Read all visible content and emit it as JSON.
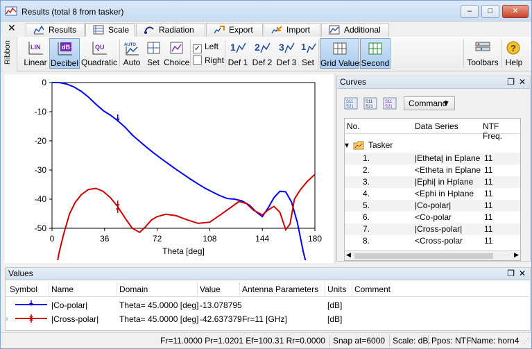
{
  "window": {
    "title": "Results (total 8 from tasker)",
    "buttons": [
      "–",
      "□",
      "✕"
    ]
  },
  "tabs": [
    {
      "label": "Results"
    },
    {
      "label": "Scale",
      "active": true
    },
    {
      "label": "Radiation"
    },
    {
      "label": "Export"
    },
    {
      "label": "Import"
    },
    {
      "label": "Additional"
    }
  ],
  "ribbon": {
    "side_label": "Ribbon",
    "close": "✕",
    "buttons": {
      "linear": "Linear",
      "decibel": "Decibel",
      "quadratic": "Quadratic",
      "auto": "Auto",
      "set": "Set",
      "choice": "Choice",
      "def1": "Def 1",
      "def2": "Def 2",
      "def3": "Def 3",
      "set2": "Set",
      "grid_values": "Grid Values",
      "second": "Second",
      "toolbars": "Toolbars",
      "help": "Help"
    },
    "left_check": {
      "label": "Left",
      "checked": true
    },
    "right_check": {
      "label": "Right",
      "checked": false
    },
    "icon_text": {
      "lin": "LIN",
      "db": "dB",
      "qu": "QU",
      "auto": "AUTO"
    }
  },
  "plot": {
    "xlabel": "Theta [deg]",
    "x_ticks": [
      "0",
      "36",
      "72",
      "108",
      "144",
      "180"
    ],
    "y_ticks": [
      "0",
      "-10",
      "-20",
      "-30",
      "-40",
      "-50"
    ]
  },
  "chart_data": {
    "type": "line",
    "xlabel": "Theta [deg]",
    "ylabel": "",
    "xlim": [
      0,
      180
    ],
    "ylim": [
      -50,
      0
    ],
    "grid": false,
    "series": [
      {
        "name": "|Co-polar|",
        "color": "#0000ff",
        "x": [
          0,
          5,
          10,
          15,
          20,
          25,
          30,
          35,
          40,
          45,
          50,
          55,
          60,
          65,
          70,
          75,
          80,
          85,
          90,
          95,
          100,
          105,
          110,
          115,
          120,
          125,
          130,
          135,
          140,
          144,
          148,
          152,
          156,
          160,
          164,
          168,
          172,
          176
        ],
        "y": [
          0,
          0,
          -0.5,
          -1.5,
          -3,
          -5,
          -7.4,
          -9.6,
          -11.2,
          -13.1,
          -15.3,
          -18,
          -20.2,
          -22.3,
          -24.3,
          -26.2,
          -28,
          -29.8,
          -31.5,
          -33.2,
          -34.8,
          -36.3,
          -37.6,
          -38.8,
          -39.8,
          -40,
          -40.6,
          -42,
          -44.5,
          -46,
          -43,
          -39.5,
          -37.3,
          -37.5,
          -41,
          -48,
          -58,
          -66
        ]
      },
      {
        "name": "|Cross-polar|",
        "color": "#cc0000",
        "x": [
          2,
          5,
          8,
          12,
          16,
          20,
          25,
          30,
          35,
          40,
          45,
          50,
          55,
          60,
          64,
          68,
          72,
          78,
          85,
          92,
          100,
          108,
          115,
          122,
          128,
          133,
          138,
          144,
          148,
          152,
          156,
          160,
          163,
          166,
          170,
          175,
          180
        ],
        "y": [
          -66,
          -58,
          -52,
          -45,
          -41,
          -38.5,
          -36.7,
          -36.3,
          -37.3,
          -39.5,
          -42.6,
          -46.5,
          -50,
          -51.4,
          -49.5,
          -47.2,
          -46,
          -45.2,
          -45.7,
          -47,
          -48.3,
          -47.9,
          -45.5,
          -43,
          -40.8,
          -41.5,
          -43.8,
          -45.4,
          -43.7,
          -42.5,
          -44.5,
          -50.5,
          -48.5,
          -40,
          -36.8,
          -33.8,
          -31.5
        ]
      }
    ]
  },
  "curves": {
    "title": "Curves",
    "command_label": "Command",
    "columns": [
      "No.",
      "Data Series",
      "NTF Freq."
    ],
    "group": "Tasker",
    "rows": [
      {
        "no": "1.",
        "series": "|Etheta| in Eplane",
        "freq": "11"
      },
      {
        "no": "2.",
        "series": "<Etheta in Eplane",
        "freq": "11"
      },
      {
        "no": "3.",
        "series": "|Ephi| in Hplane",
        "freq": "11"
      },
      {
        "no": "4.",
        "series": "<Ephi in Hplane",
        "freq": "11"
      },
      {
        "no": "5.",
        "series": "|Co-polar|",
        "freq": "11"
      },
      {
        "no": "6.",
        "series": "<Co-polar",
        "freq": "11"
      },
      {
        "no": "7.",
        "series": "|Cross-polar|",
        "freq": "11"
      },
      {
        "no": "8.",
        "series": "<Cross-polar",
        "freq": "11"
      }
    ]
  },
  "values": {
    "title": "Values",
    "columns": [
      "Symbol",
      "Name",
      "Domain",
      "Value",
      "Antenna Parameters",
      "Units",
      "Comment"
    ],
    "rows": [
      {
        "name": "|Co-polar|",
        "domain": "Theta= 45.0000 [deg]",
        "value": "-13.078795",
        "params": "",
        "units": "[dB]",
        "color": "#0000ff"
      },
      {
        "name": "|Cross-polar|",
        "domain": "Theta= 45.0000 [deg]",
        "value": "-42.637379",
        "params": "Fr=11 [GHz]",
        "units": "[dB]",
        "color": "#cc0000"
      }
    ]
  },
  "status": {
    "params": "Fr=11.0000 Pr=1.0201 Ef=100.31 Rr=0.0000",
    "snap": "Snap at=6000",
    "scale": "Scale: dB.",
    "ppos": "Ppos: NTF",
    "name": "Name: horn4"
  }
}
